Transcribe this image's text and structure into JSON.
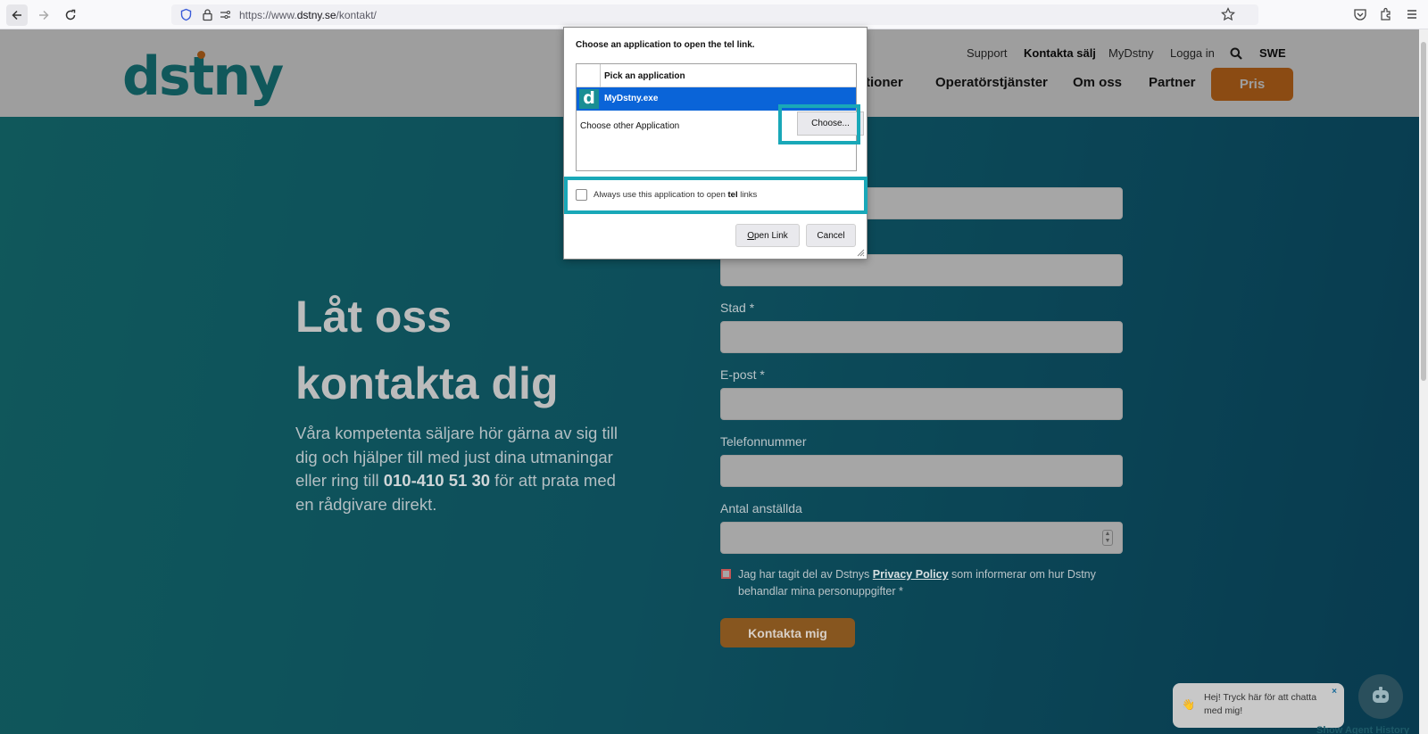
{
  "browser": {
    "url_prefix": "https://www.",
    "url_domain": "dstny.se",
    "url_path": "/kontakt/"
  },
  "header": {
    "logo_left": "ds",
    "logo_t": "t",
    "logo_right": "ny",
    "top_links": [
      "Support",
      "Kontakta sälj",
      "MyDstny",
      "Logga in",
      "SWE"
    ],
    "main_nav_partial": "tioner",
    "main_nav": [
      "Operatörstjänster",
      "Om oss",
      "Partner"
    ],
    "pris_label": "Pris"
  },
  "hero": {
    "title_line1": "Låt oss",
    "title_line2": "kontakta dig",
    "text_before": "Våra kompetenta säljare hör gärna av sig till dig och hjälper till med just dina utmaningar eller ring till ",
    "phone": "010-410 51 30",
    "text_after": " för att prata med en rådgivare direkt."
  },
  "form": {
    "labels": {
      "city": "Stad *",
      "email": "E-post *",
      "phone": "Telefonnummer",
      "employees": "Antal anställda"
    },
    "consent_before": "Jag har tagit del av Dstnys ",
    "consent_link": "Privacy Policy",
    "consent_after": " som informerar om hur Dstny behandlar mina personuppgifter *",
    "submit_label": "Kontakta mig"
  },
  "chat": {
    "bubble_text": "Hej! Tryck här för att chatta med mig!",
    "close_label": "×",
    "agent_history": "Show Agent History"
  },
  "dialog": {
    "title": "Choose an application to open the tel link.",
    "list_header": "Pick an application",
    "selected_app": "MyDstny.exe",
    "other_label": "Choose other Application",
    "choose_button": "Choose...",
    "always_before": "Always use this application to open ",
    "always_bold": "tel",
    "always_after": " links",
    "open_link_first": "O",
    "open_link_rest": "pen Link",
    "cancel_label": "Cancel"
  },
  "colors": {
    "brand_teal": "#1a8e94",
    "brand_orange": "#e07a1f",
    "highlight": "#19a8b8",
    "selection_blue": "#0a64d8"
  }
}
